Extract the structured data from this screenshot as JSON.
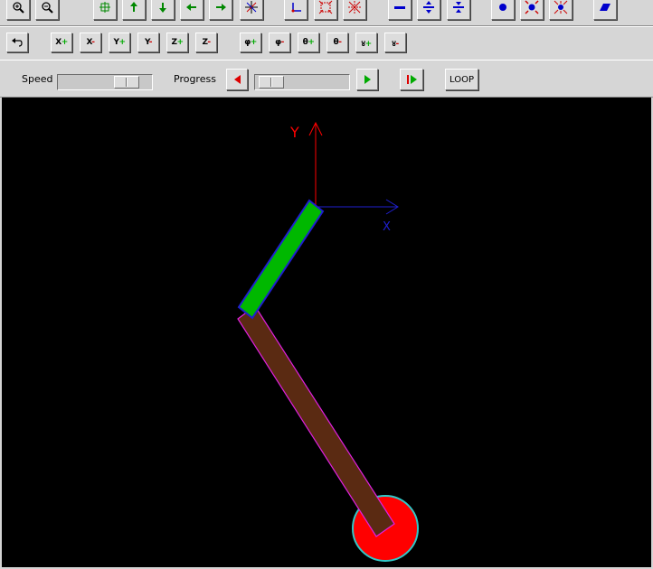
{
  "toolbar_view": {
    "buttons": [
      {
        "name": "zoom-in-icon"
      },
      {
        "name": "zoom-out-icon"
      },
      {
        "name": "pan-center-icon"
      },
      {
        "name": "arrow-up-icon"
      },
      {
        "name": "arrow-down-icon"
      },
      {
        "name": "arrow-left-icon"
      },
      {
        "name": "arrow-right-icon"
      },
      {
        "name": "axes-origin-icon"
      },
      {
        "name": "frame-axes-icon"
      },
      {
        "name": "expand-arrows-icon"
      },
      {
        "name": "contract-arrows-icon"
      },
      {
        "name": "line-bar-icon"
      },
      {
        "name": "line-expand-icon"
      },
      {
        "name": "line-contract-icon"
      },
      {
        "name": "point-dot-icon"
      },
      {
        "name": "point-expand-icon"
      },
      {
        "name": "point-contract-icon"
      },
      {
        "name": "plane-shape-icon"
      }
    ]
  },
  "toolbar_rotate": {
    "undo_icon": "undo-icon",
    "buttons": [
      {
        "axis": "X",
        "sign": "+"
      },
      {
        "axis": "X",
        "sign": "-"
      },
      {
        "axis": "Y",
        "sign": "+"
      },
      {
        "axis": "Y",
        "sign": "-"
      },
      {
        "axis": "Z",
        "sign": "+"
      },
      {
        "axis": "Z",
        "sign": "-"
      },
      {
        "axis": "φ",
        "sign": "+"
      },
      {
        "axis": "φ",
        "sign": "-"
      },
      {
        "axis": "θ",
        "sign": "+"
      },
      {
        "axis": "θ",
        "sign": "-"
      },
      {
        "axis": "४",
        "sign": "+"
      },
      {
        "axis": "४",
        "sign": "-"
      }
    ]
  },
  "controls": {
    "speed_label": "Speed",
    "speed_value": 0.82,
    "progress_label": "Progress",
    "progress_value": 0.05,
    "step_back_icon": "triangle-left-icon",
    "step_forward_icon": "triangle-right-icon",
    "play_icon": "play-icon",
    "loop_label": "LOOP"
  },
  "viewport": {
    "axis_y_label": "Y",
    "axis_x_label": "X",
    "colors": {
      "background": "#000000",
      "axis_y": "#ff0000",
      "axis_x": "#1f1fd0",
      "link_upper_fill": "#00b800",
      "link_upper_edge": "#1f1fd0",
      "link_lower_fill": "#5a2a12",
      "link_lower_edge": "#e020e0",
      "end_effector_fill": "#ff0000",
      "end_effector_edge": "#30c8c8"
    }
  }
}
